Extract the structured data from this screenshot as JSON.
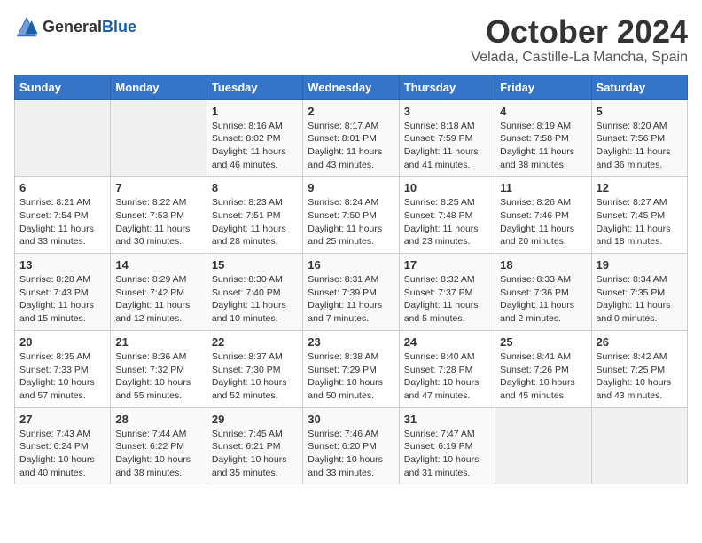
{
  "logo": {
    "general": "General",
    "blue": "Blue"
  },
  "title": "October 2024",
  "location": "Velada, Castille-La Mancha, Spain",
  "weekdays": [
    "Sunday",
    "Monday",
    "Tuesday",
    "Wednesday",
    "Thursday",
    "Friday",
    "Saturday"
  ],
  "weeks": [
    [
      {
        "day": "",
        "detail": ""
      },
      {
        "day": "",
        "detail": ""
      },
      {
        "day": "1",
        "detail": "Sunrise: 8:16 AM\nSunset: 8:02 PM\nDaylight: 11 hours and 46 minutes."
      },
      {
        "day": "2",
        "detail": "Sunrise: 8:17 AM\nSunset: 8:01 PM\nDaylight: 11 hours and 43 minutes."
      },
      {
        "day": "3",
        "detail": "Sunrise: 8:18 AM\nSunset: 7:59 PM\nDaylight: 11 hours and 41 minutes."
      },
      {
        "day": "4",
        "detail": "Sunrise: 8:19 AM\nSunset: 7:58 PM\nDaylight: 11 hours and 38 minutes."
      },
      {
        "day": "5",
        "detail": "Sunrise: 8:20 AM\nSunset: 7:56 PM\nDaylight: 11 hours and 36 minutes."
      }
    ],
    [
      {
        "day": "6",
        "detail": "Sunrise: 8:21 AM\nSunset: 7:54 PM\nDaylight: 11 hours and 33 minutes."
      },
      {
        "day": "7",
        "detail": "Sunrise: 8:22 AM\nSunset: 7:53 PM\nDaylight: 11 hours and 30 minutes."
      },
      {
        "day": "8",
        "detail": "Sunrise: 8:23 AM\nSunset: 7:51 PM\nDaylight: 11 hours and 28 minutes."
      },
      {
        "day": "9",
        "detail": "Sunrise: 8:24 AM\nSunset: 7:50 PM\nDaylight: 11 hours and 25 minutes."
      },
      {
        "day": "10",
        "detail": "Sunrise: 8:25 AM\nSunset: 7:48 PM\nDaylight: 11 hours and 23 minutes."
      },
      {
        "day": "11",
        "detail": "Sunrise: 8:26 AM\nSunset: 7:46 PM\nDaylight: 11 hours and 20 minutes."
      },
      {
        "day": "12",
        "detail": "Sunrise: 8:27 AM\nSunset: 7:45 PM\nDaylight: 11 hours and 18 minutes."
      }
    ],
    [
      {
        "day": "13",
        "detail": "Sunrise: 8:28 AM\nSunset: 7:43 PM\nDaylight: 11 hours and 15 minutes."
      },
      {
        "day": "14",
        "detail": "Sunrise: 8:29 AM\nSunset: 7:42 PM\nDaylight: 11 hours and 12 minutes."
      },
      {
        "day": "15",
        "detail": "Sunrise: 8:30 AM\nSunset: 7:40 PM\nDaylight: 11 hours and 10 minutes."
      },
      {
        "day": "16",
        "detail": "Sunrise: 8:31 AM\nSunset: 7:39 PM\nDaylight: 11 hours and 7 minutes."
      },
      {
        "day": "17",
        "detail": "Sunrise: 8:32 AM\nSunset: 7:37 PM\nDaylight: 11 hours and 5 minutes."
      },
      {
        "day": "18",
        "detail": "Sunrise: 8:33 AM\nSunset: 7:36 PM\nDaylight: 11 hours and 2 minutes."
      },
      {
        "day": "19",
        "detail": "Sunrise: 8:34 AM\nSunset: 7:35 PM\nDaylight: 11 hours and 0 minutes."
      }
    ],
    [
      {
        "day": "20",
        "detail": "Sunrise: 8:35 AM\nSunset: 7:33 PM\nDaylight: 10 hours and 57 minutes."
      },
      {
        "day": "21",
        "detail": "Sunrise: 8:36 AM\nSunset: 7:32 PM\nDaylight: 10 hours and 55 minutes."
      },
      {
        "day": "22",
        "detail": "Sunrise: 8:37 AM\nSunset: 7:30 PM\nDaylight: 10 hours and 52 minutes."
      },
      {
        "day": "23",
        "detail": "Sunrise: 8:38 AM\nSunset: 7:29 PM\nDaylight: 10 hours and 50 minutes."
      },
      {
        "day": "24",
        "detail": "Sunrise: 8:40 AM\nSunset: 7:28 PM\nDaylight: 10 hours and 47 minutes."
      },
      {
        "day": "25",
        "detail": "Sunrise: 8:41 AM\nSunset: 7:26 PM\nDaylight: 10 hours and 45 minutes."
      },
      {
        "day": "26",
        "detail": "Sunrise: 8:42 AM\nSunset: 7:25 PM\nDaylight: 10 hours and 43 minutes."
      }
    ],
    [
      {
        "day": "27",
        "detail": "Sunrise: 7:43 AM\nSunset: 6:24 PM\nDaylight: 10 hours and 40 minutes."
      },
      {
        "day": "28",
        "detail": "Sunrise: 7:44 AM\nSunset: 6:22 PM\nDaylight: 10 hours and 38 minutes."
      },
      {
        "day": "29",
        "detail": "Sunrise: 7:45 AM\nSunset: 6:21 PM\nDaylight: 10 hours and 35 minutes."
      },
      {
        "day": "30",
        "detail": "Sunrise: 7:46 AM\nSunset: 6:20 PM\nDaylight: 10 hours and 33 minutes."
      },
      {
        "day": "31",
        "detail": "Sunrise: 7:47 AM\nSunset: 6:19 PM\nDaylight: 10 hours and 31 minutes."
      },
      {
        "day": "",
        "detail": ""
      },
      {
        "day": "",
        "detail": ""
      }
    ]
  ]
}
